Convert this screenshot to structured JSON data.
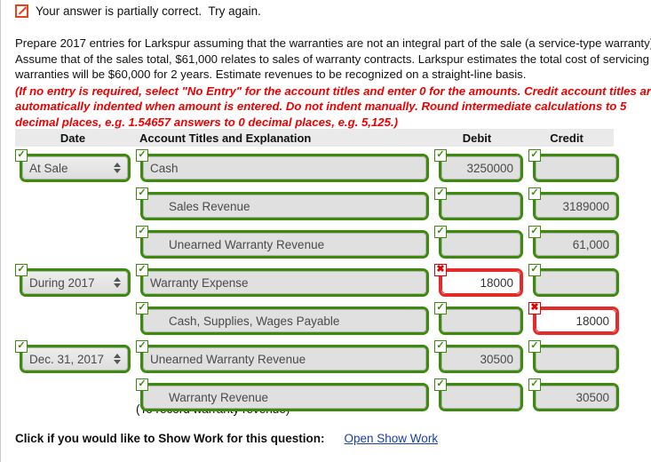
{
  "status": {
    "icon": "pencil-slash-icon",
    "text": "Your answer is partially correct.  Try again."
  },
  "instructions": {
    "body": "Prepare 2017 entries for Larkspur assuming that the warranties are not an integral part of the sale (a service-type warranty). Assume that of the sales total, $61,000 relates to sales of warranty contracts. Larkspur estimates the total cost of servicing the warranties will be $60,000 for 2 years. Estimate revenues to be recognized on a straight-line basis.",
    "emphasis": "(If no entry is required, select \"No Entry\" for the account titles and enter 0 for the amounts. Credit account titles are automatically indented when amount is entered. Do not indent manually. Round intermediate calculations to 5 decimal places, e.g. 1.54657 answers to 0 decimal places, e.g. 5,125.)"
  },
  "table": {
    "headers": {
      "date": "Date",
      "account": "Account Titles and Explanation",
      "debit": "Debit",
      "credit": "Credit"
    },
    "rows": [
      {
        "date": {
          "type": "select",
          "value": "At Sale",
          "state": "ok"
        },
        "account": {
          "value": "Cash",
          "indent": false,
          "state": "ok"
        },
        "debit": {
          "value": "3250000",
          "state": "ok"
        },
        "credit": {
          "value": "",
          "state": "ok"
        }
      },
      {
        "date": {
          "type": "none"
        },
        "account": {
          "value": "Sales Revenue",
          "indent": true,
          "state": "ok"
        },
        "debit": {
          "value": "",
          "state": "ok"
        },
        "credit": {
          "value": "3189000",
          "state": "ok"
        }
      },
      {
        "date": {
          "type": "none"
        },
        "account": {
          "value": "Unearned Warranty Revenue",
          "indent": true,
          "state": "ok"
        },
        "debit": {
          "value": "",
          "state": "ok"
        },
        "credit": {
          "value": "61,000",
          "state": "ok"
        }
      },
      {
        "date": {
          "type": "select",
          "value": "During 2017",
          "state": "ok"
        },
        "account": {
          "value": "Warranty Expense",
          "indent": false,
          "state": "ok"
        },
        "debit": {
          "value": "18000",
          "state": "error"
        },
        "credit": {
          "value": "",
          "state": "ok"
        }
      },
      {
        "date": {
          "type": "none"
        },
        "account": {
          "value": "Cash, Supplies, Wages Payable",
          "indent": true,
          "state": "ok"
        },
        "debit": {
          "value": "",
          "state": "ok"
        },
        "credit": {
          "value": "18000",
          "state": "error"
        }
      },
      {
        "date": {
          "type": "select",
          "value": "Dec. 31, 2017",
          "state": "ok"
        },
        "account": {
          "value": "Unearned Warranty Revenue",
          "indent": false,
          "state": "ok"
        },
        "debit": {
          "value": "30500",
          "state": "ok"
        },
        "credit": {
          "value": "",
          "state": "ok"
        }
      },
      {
        "date": {
          "type": "none"
        },
        "account": {
          "value": "Warranty Revenue",
          "indent": true,
          "state": "ok"
        },
        "debit": {
          "value": "",
          "state": "ok"
        },
        "credit": {
          "value": "30500",
          "state": "ok"
        }
      }
    ],
    "memo": "(To record warranty revenue)"
  },
  "footer": {
    "label": "Click if you would like to Show Work for this question:",
    "link": "Open Show Work"
  },
  "colors": {
    "valid_border": "#3d8b0d",
    "error_border": "#e52a2a",
    "error_icon": "#e00000",
    "instruction_emphasis": "#ee0000",
    "link": "#1a3faa",
    "header_bg": "#eaeaea",
    "field_bg": "#e0e0e0"
  }
}
